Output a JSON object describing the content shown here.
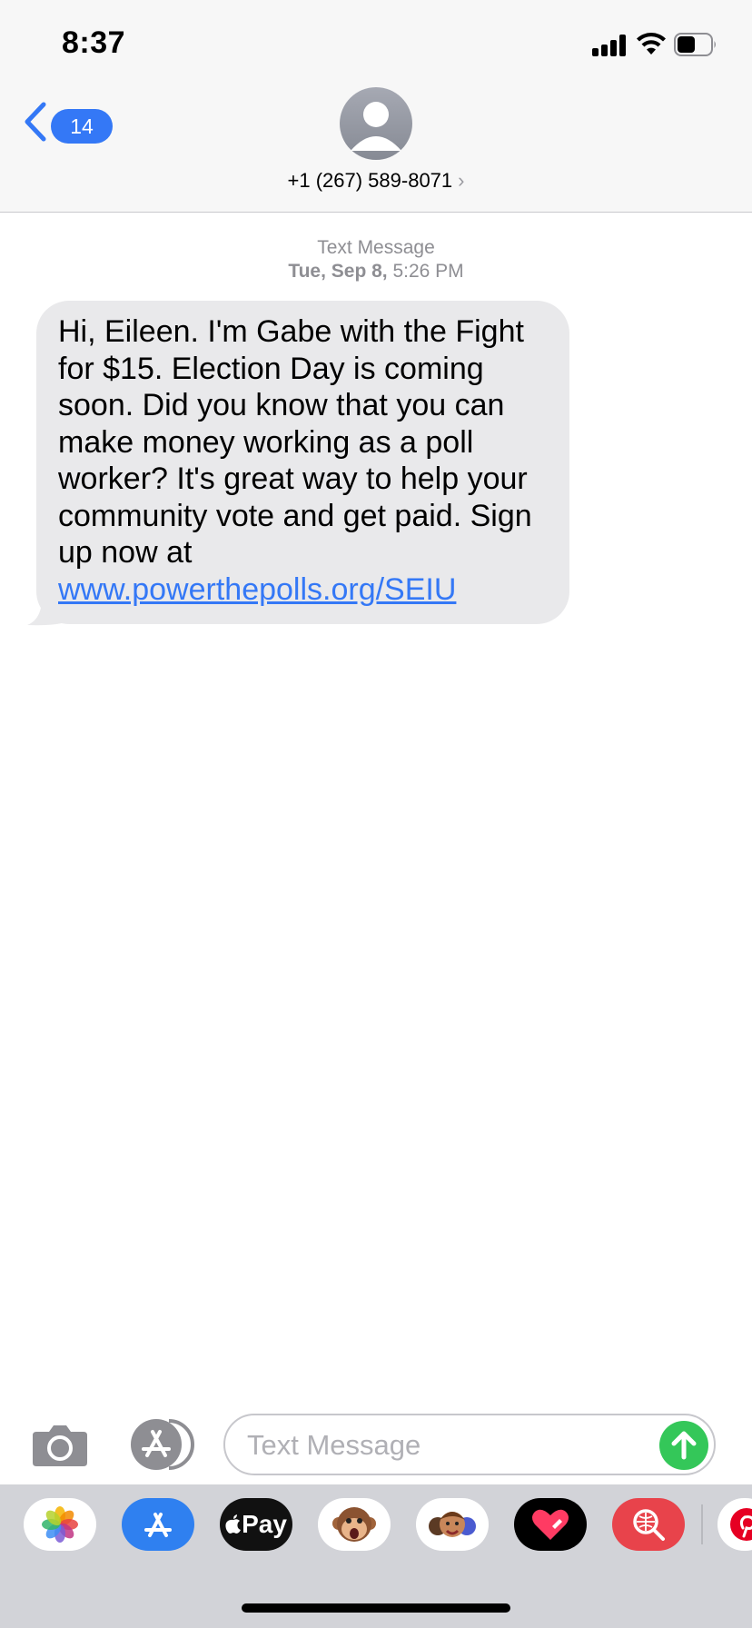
{
  "status_bar": {
    "time": "8:37"
  },
  "header": {
    "back_badge": "14",
    "contact": "+1 (267) 589-8071",
    "contact_chevron": "›"
  },
  "conversation": {
    "service": "Text Message",
    "date": "Tue, Sep 8,",
    "time": "5:26 PM",
    "message": {
      "text": "Hi, Eileen. I'm Gabe with the Fight for $15. Election Day is coming soon. Did you know that you can make money working as a poll worker? It's great way to help your community vote and get paid. Sign up now at ",
      "link": "www.powerthepolls.org/SEIU"
    }
  },
  "input": {
    "placeholder": "Text Message"
  },
  "app_drawer": {
    "apps": [
      "photos-icon",
      "app-store-icon",
      "apple-pay-icon",
      "animoji-monkey-icon",
      "memoji-icon",
      "heart-sticker-icon",
      "image-search-icon",
      "pinterest-icon"
    ],
    "apple_pay_label": "Pay"
  },
  "colors": {
    "accent": "#3478f6",
    "bubble": "#e9e9eb",
    "send": "#34c759",
    "drawer": "#d2d3d8"
  }
}
